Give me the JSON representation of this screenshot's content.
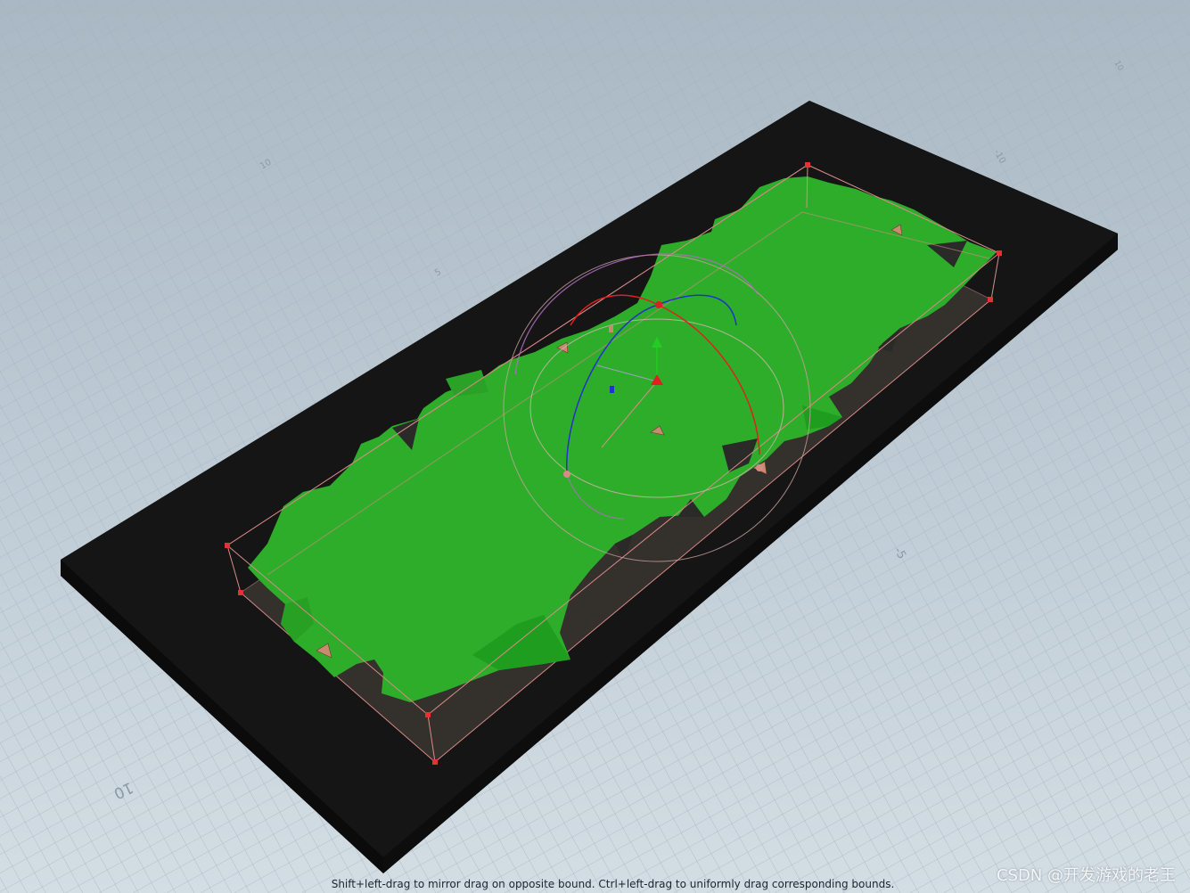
{
  "viewport": {
    "grid_labels": [
      "10",
      "-5",
      "5",
      "10",
      "-10",
      "10"
    ],
    "tool": "bound-handle",
    "colors": {
      "background_top": "#a9b8c4",
      "background_bottom": "#d3dde4",
      "ground": "#151515",
      "terrain": "#2ead2a",
      "terrain_dark": "#1e9d1e",
      "bounds": "#d98a88",
      "gizmo_x": "#e02020",
      "gizmo_y": "#22cc22",
      "gizmo_z": "#2233cc",
      "gizmo_ring": "#c9a1a1"
    }
  },
  "status": {
    "message": "Shift+left-drag to mirror drag on opposite bound. Ctrl+left-drag to uniformly drag corresponding bounds."
  },
  "watermark": {
    "text": "CSDN @开发游戏的老王"
  }
}
